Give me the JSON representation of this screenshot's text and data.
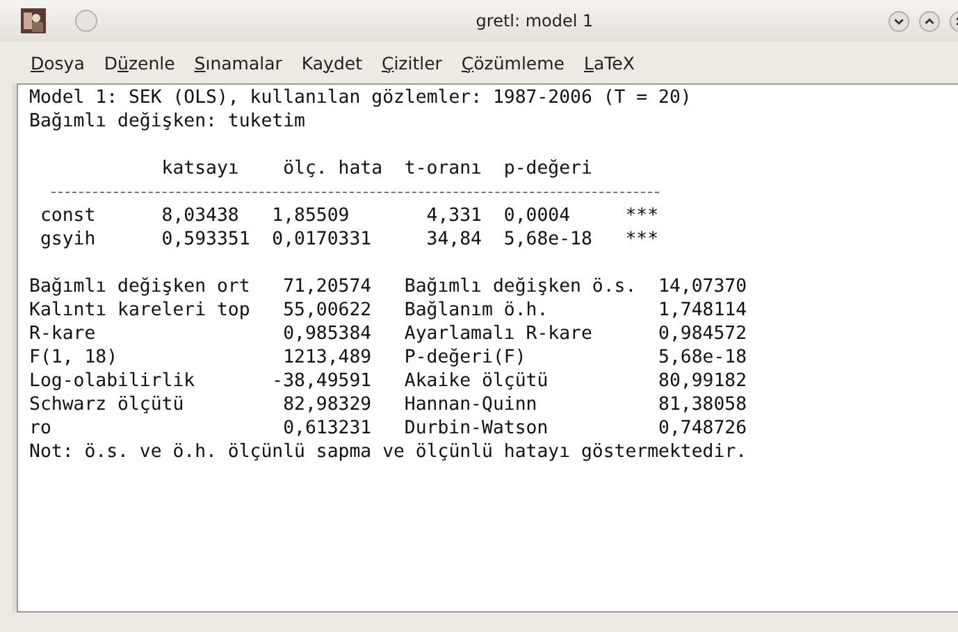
{
  "window": {
    "title": "gretl: model 1"
  },
  "menu": [
    {
      "key": "D",
      "post": "osya"
    },
    {
      "pre": "D",
      "key": "ü",
      "post": "zenle"
    },
    {
      "key": "S",
      "post": "ınamalar"
    },
    {
      "pre": "Ka",
      "key": "y",
      "post": "det"
    },
    {
      "key": "Ç",
      "post": "izitler"
    },
    {
      "key": "Ç",
      "post": "özümleme"
    },
    {
      "key": "L",
      "post": "aTeX"
    }
  ],
  "output": {
    "heading": "Model 1: SEK (OLS), kullanılan gözlemler: 1987-2006 (T = 20)",
    "dependent": "Bağımlı değişken: tuketim",
    "columns": [
      "katsayı",
      "ölç. hata",
      "t-oranı",
      "p-değeri"
    ],
    "rows": [
      {
        "name": "const",
        "coef": "8,03438",
        "se": "1,85509",
        "t": "4,331",
        "p": "0,0004",
        "stars": "***"
      },
      {
        "name": "gsyih",
        "coef": "0,593351",
        "se": "0,0170331",
        "t": "34,84",
        "p": "5,68e-18",
        "stars": "***"
      }
    ],
    "stats": [
      [
        "Bağımlı değişken ort",
        "71,20574",
        "Bağımlı değişken ö.s.",
        "14,07370"
      ],
      [
        "Kalıntı kareleri top",
        "55,00622",
        "Bağlanım ö.h.",
        "1,748114"
      ],
      [
        "R-kare",
        "0,985384",
        "Ayarlamalı R-kare",
        "0,984572"
      ],
      [
        "F(1, 18)",
        "1213,489",
        "P-değeri(F)",
        "5,68e-18"
      ],
      [
        "Log-olabilirlik",
        "-38,49591",
        "Akaike ölçütü",
        "80,99182"
      ],
      [
        "Schwarz ölçütü",
        "82,98329",
        "Hannan-Quinn",
        "81,38058"
      ],
      [
        "ro",
        "0,613231",
        "Durbin-Watson",
        "0,748726"
      ]
    ],
    "note": "Not: ö.s. ve ö.h. ölçünlü sapma ve ölçünlü hatayı göstermektedir."
  }
}
